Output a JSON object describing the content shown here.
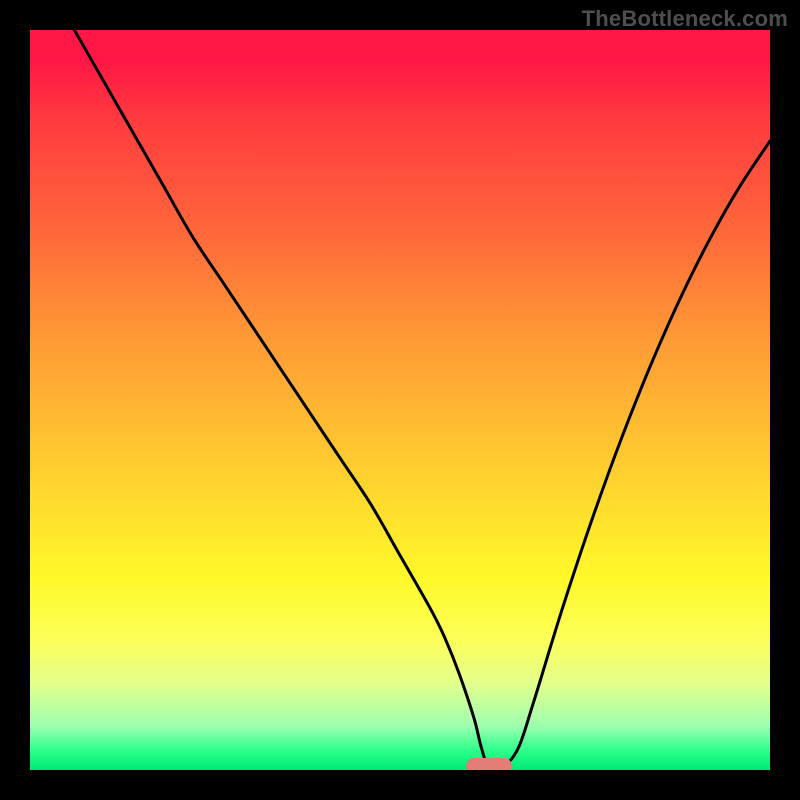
{
  "watermark": "TheBottleneck.com",
  "chart_data": {
    "type": "line",
    "title": "",
    "xlabel": "",
    "ylabel": "",
    "xlim": [
      0,
      100
    ],
    "ylim": [
      0,
      100
    ],
    "grid": false,
    "legend": false,
    "gradient_note": "Background vertical gradient: red (top, ~100) → orange → yellow → green (bottom, ~0)",
    "series": [
      {
        "name": "bottleneck-curve",
        "x": [
          6,
          10,
          14,
          18,
          22,
          26,
          30,
          34,
          38,
          42,
          46,
          50,
          54,
          56,
          58,
          60,
          61,
          62,
          64,
          66,
          68,
          72,
          76,
          80,
          84,
          88,
          92,
          96,
          100
        ],
        "y": [
          100,
          93,
          86,
          79,
          72,
          66,
          60,
          54,
          48,
          42,
          36,
          29,
          22,
          18,
          13,
          7,
          3,
          0.5,
          0.5,
          3,
          9,
          22,
          34,
          45,
          55,
          64,
          72,
          79,
          85
        ]
      }
    ],
    "marker": {
      "x": 62,
      "y": 0.5,
      "label": "optimal-zone"
    }
  }
}
